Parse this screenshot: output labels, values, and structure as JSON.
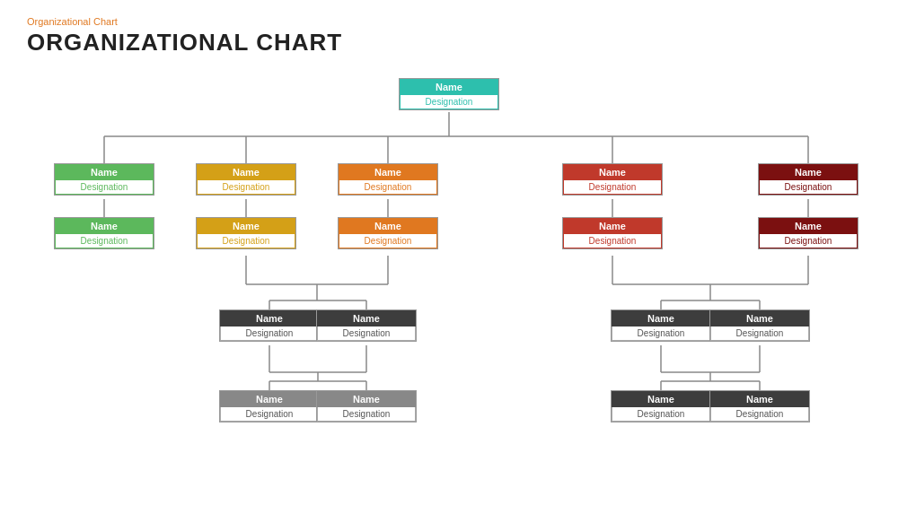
{
  "page": {
    "subtitle": "Organizational  Chart",
    "title": "ORGANIZATIONAL CHART"
  },
  "nodes": {
    "root": {
      "name": "Name",
      "desig": "Designation"
    },
    "l1": [
      {
        "name": "Name",
        "desig": "Designation",
        "color": "green"
      },
      {
        "name": "Name",
        "desig": "Designation",
        "color": "yellow"
      },
      {
        "name": "Name",
        "desig": "Designation",
        "color": "orange"
      },
      {
        "name": "Name",
        "desig": "Designation",
        "color": "red"
      },
      {
        "name": "Name",
        "desig": "Designation",
        "color": "darkred"
      }
    ],
    "l2": [
      {
        "name": "Name",
        "desig": "Designation",
        "color": "green"
      },
      {
        "name": "Name",
        "desig": "Designation",
        "color": "yellow"
      },
      {
        "name": "Name",
        "desig": "Designation",
        "color": "orange"
      },
      {
        "name": "Name",
        "desig": "Designation",
        "color": "red"
      },
      {
        "name": "Name",
        "desig": "Designation",
        "color": "darkred"
      }
    ],
    "l3_left": [
      {
        "name": "Name",
        "desig": "Designation",
        "color": "darkgray"
      },
      {
        "name": "Name",
        "desig": "Designation",
        "color": "darkgray"
      }
    ],
    "l3_right": [
      {
        "name": "Name",
        "desig": "Designation",
        "color": "darkgray"
      },
      {
        "name": "Name",
        "desig": "Designation",
        "color": "darkgray"
      }
    ],
    "l4_left": [
      {
        "name": "Name",
        "desig": "Designation",
        "color": "lightgray"
      },
      {
        "name": "Name",
        "desig": "Designation",
        "color": "lightgray"
      }
    ],
    "l4_right": [
      {
        "name": "Name",
        "desig": "Designation",
        "color": "darkgray"
      },
      {
        "name": "Name",
        "desig": "Designation",
        "color": "darkgray"
      }
    ]
  }
}
